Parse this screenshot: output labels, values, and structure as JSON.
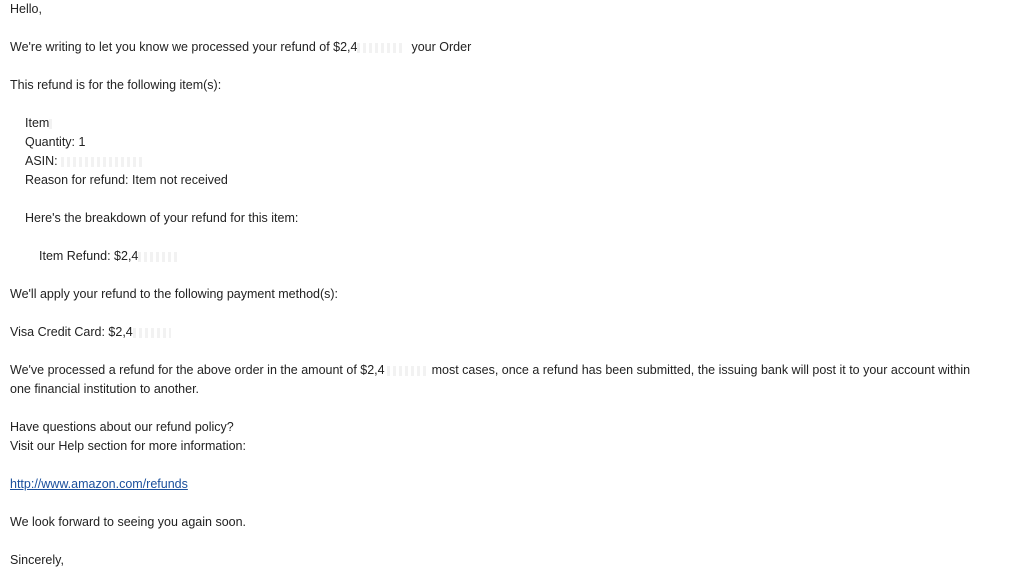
{
  "email": {
    "greeting": "Hello,",
    "intro_prefix": "We're writing to let you know we processed your refund of $2,4",
    "intro_suffix": "your Order",
    "items_heading": "This refund is for the following item(s):",
    "item_label": "Item",
    "quantity": "Quantity: 1",
    "asin_label": "ASIN:",
    "reason": "Reason for refund: Item not received",
    "breakdown_heading": "Here's the breakdown of your refund for this item:",
    "item_refund": "Item Refund: $2,4",
    "payment_heading": "We'll apply your refund to the following payment method(s):",
    "payment_method": "Visa Credit Card: $2,4",
    "processed_prefix": "We've processed a refund for the above order in the amount of $2,4",
    "processed_suffix": "most cases, once a refund has been submitted, the issuing bank will post it to your account within",
    "processed_line2": "one financial institution to another.",
    "questions": "Have questions about our refund policy?",
    "help_text": "Visit our Help section for more information:",
    "help_link": "http://www.amazon.com/refunds",
    "closing": "We look forward to seeing you again soon.",
    "signoff": "Sincerely,"
  }
}
